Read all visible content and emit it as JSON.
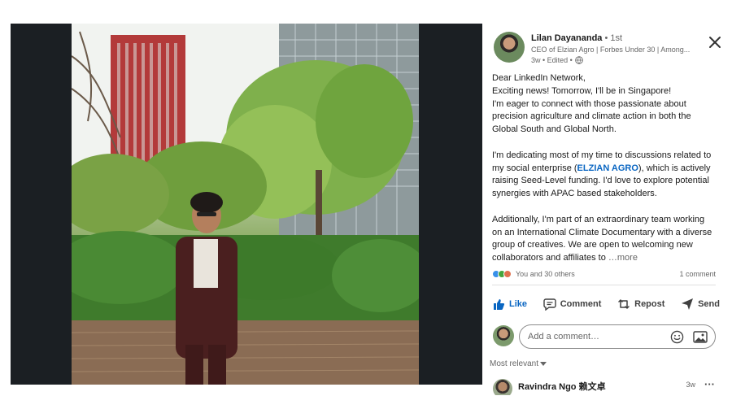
{
  "author": {
    "name": "Lilan Dayananda",
    "degree": " • 1st",
    "headline": "CEO of Elzian Agro | Forbes Under 30 | Among...",
    "post_time": "3w • Edited •"
  },
  "post": {
    "greeting": "Dear LinkedIn Network,",
    "line1": "Exciting news! Tomorrow, I'll be in Singapore!",
    "line2": "I'm eager to connect with those passionate about precision agriculture and climate action in both the Global South and Global North.",
    "para2_before": "I'm dedicating most of my time to discussions related to my social enterprise (",
    "para2_mention": "ELZIAN AGRO",
    "para2_after": "), which is actively raising Seed-Level funding. I'd love to explore potential synergies with APAC based stakeholders.",
    "para3": "Additionally, I'm part of an extraordinary team working on an International Climate Documentary with a diverse group of creatives. We are open to welcoming new collaborators and affiliates to",
    "more_label": "…more"
  },
  "engagement": {
    "reactions_text": "You and 30 others",
    "comments_text": "1 comment"
  },
  "actions": {
    "like": "Like",
    "comment": "Comment",
    "repost": "Repost",
    "send": "Send"
  },
  "comment_input": {
    "placeholder": "Add a comment…"
  },
  "comments": {
    "sort_label": "Most relevant",
    "first": {
      "name": "Ravindra Ngo 赖文卓",
      "time": "3w"
    }
  },
  "colors": {
    "accent": "#0a66c2",
    "muted": "#666666",
    "backdrop": "#1b1f23"
  },
  "icons": [
    "close-icon",
    "globe-icon",
    "like-icon",
    "comment-icon",
    "repost-icon",
    "send-icon",
    "emoji-icon",
    "image-icon",
    "caret-down-icon",
    "more-icon"
  ]
}
